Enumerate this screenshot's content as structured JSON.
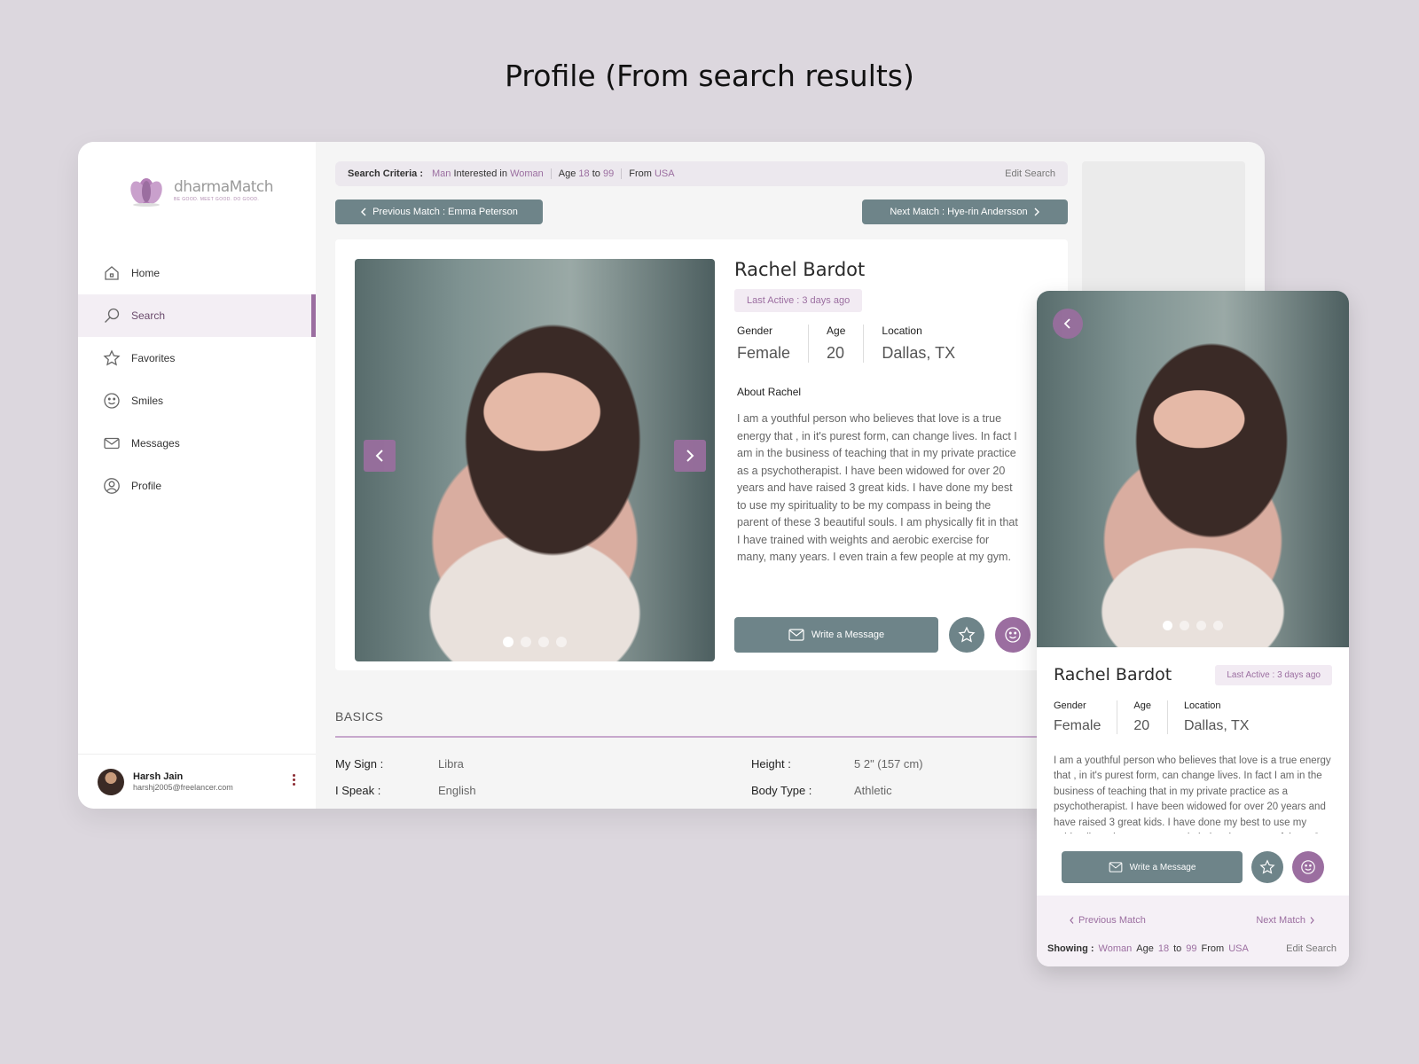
{
  "page_heading": "Profile (From search results)",
  "brand": {
    "name": "dharmaMatch",
    "tagline": "BE GOOD. MEET GOOD. DO GOOD."
  },
  "nav": [
    {
      "label": "Home",
      "icon": "home-icon",
      "active": false
    },
    {
      "label": "Search",
      "icon": "search-icon",
      "active": true
    },
    {
      "label": "Favorites",
      "icon": "star-icon",
      "active": false
    },
    {
      "label": "Smiles",
      "icon": "smile-icon",
      "active": false
    },
    {
      "label": "Messages",
      "icon": "mail-icon",
      "active": false
    },
    {
      "label": "Profile",
      "icon": "user-icon",
      "active": false
    }
  ],
  "user": {
    "name": "Harsh Jain",
    "email": "harshj2005@freelancer.com"
  },
  "criteria": {
    "label": "Search Criteria :",
    "seeking": "Man",
    "interested_in_text": "Interested in",
    "target": "Woman",
    "age_text": "Age",
    "age_min": "18",
    "to_text": "to",
    "age_max": "99",
    "from_text": "From",
    "country": "USA",
    "edit_label": "Edit Search"
  },
  "prev_match_label": "Previous Match : Emma Peterson",
  "next_match_label": "Next Match : Hye-rin Andersson",
  "profile": {
    "name": "Rachel Bardot",
    "last_active": "Last Active : 3 days ago",
    "gender_label": "Gender",
    "gender": "Female",
    "age_label": "Age",
    "age": "20",
    "location_label": "Location",
    "location": "Dallas, TX",
    "about_title": "About Rachel",
    "about": "I am a youthful person who believes that love is a true energy that , in it's purest form, can change lives. In fact I am in the business of teaching that in my private practice as a psychotherapist. I have been widowed for over 20 years and have raised 3 great kids. I have done my best to use my spirituality to be my compass in being the parent of these 3 beautiful souls. I am physically fit in that I have trained with weights and aerobic exercise for many, many years. I even train a few people at my gym.",
    "photo_count": 4,
    "current_photo": 1
  },
  "actions": {
    "message_label": "Write a Message"
  },
  "basics": {
    "title": "BASICS",
    "sign_label": "My Sign :",
    "sign": "Libra",
    "speak_label": "I Speak :",
    "speak": "English",
    "height_label": "Height :",
    "height": "5 2\" (157 cm)",
    "body_label": "Body Type :",
    "body": "Athletic"
  },
  "mobile": {
    "prev_label": "Previous Match",
    "next_label": "Next Match",
    "showing_label": "Showing :",
    "target": "Woman",
    "age_text": "Age",
    "age_min": "18",
    "to_text": "to",
    "age_max": "99",
    "from_text": "From",
    "country": "USA",
    "edit_label": "Edit Search"
  },
  "colors": {
    "accent": "#9b6ea0",
    "slate": "#6e8489",
    "background": "#dcd7de"
  }
}
